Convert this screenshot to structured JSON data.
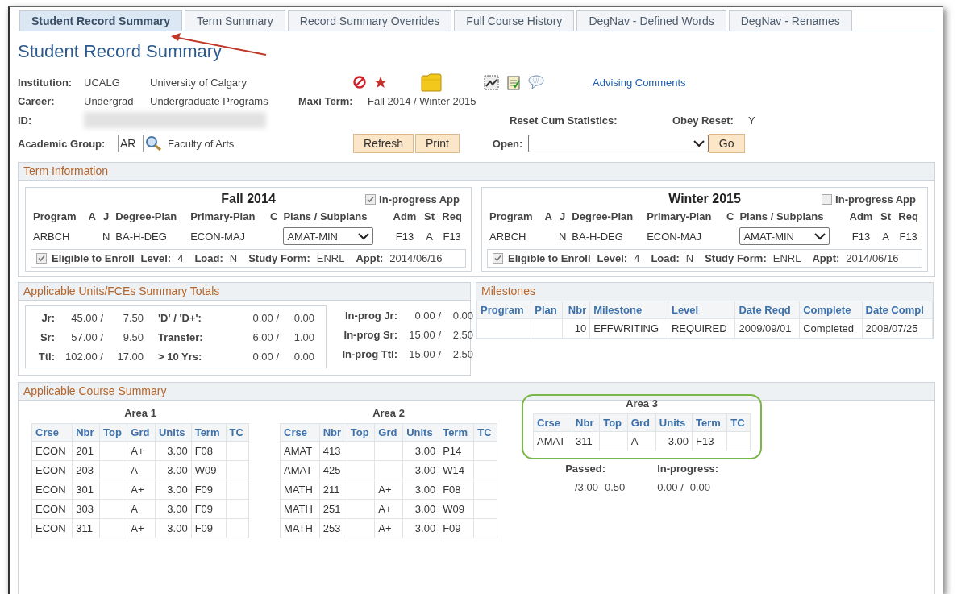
{
  "tabs": [
    {
      "label": "Student Record Summary",
      "selected": true
    },
    {
      "label": "Term Summary",
      "selected": false
    },
    {
      "label": "Record Summary Overrides",
      "selected": false
    },
    {
      "label": "Full Course History",
      "selected": false
    },
    {
      "label": "DegNav - Defined Words",
      "selected": false
    },
    {
      "label": "DegNav - Renames",
      "selected": false
    }
  ],
  "title": "Student Record Summary",
  "header": {
    "institution": {
      "label": "Institution:",
      "code": "UCALG",
      "name": "University of Calgary"
    },
    "career": {
      "label": "Career:",
      "code": "Undergrad",
      "name": "Undergraduate Programs"
    },
    "maxi_term": {
      "label": "Maxi Term:",
      "value": "Fall 2014 / Winter 2015"
    },
    "id": {
      "label": "ID:"
    },
    "reset_cum": {
      "label": "Reset Cum Statistics:"
    },
    "obey_reset": {
      "label": "Obey Reset:",
      "value": "Y"
    },
    "academic_group": {
      "label": "Academic Group:",
      "value": "AR",
      "name": "Faculty of Arts"
    },
    "buttons": [
      "Refresh",
      "Print"
    ],
    "open": {
      "label": "Open:"
    },
    "go": "Go",
    "link": "Advising Comments"
  },
  "term_information": {
    "title": "Term Information",
    "terms": [
      {
        "title": "Fall 2014",
        "in_progress": {
          "label": "In-progress App",
          "checked": true
        },
        "columns": [
          "Program",
          "A",
          "J",
          "Degree-Plan",
          "Primary-Plan",
          "C",
          "Plans / Subplans",
          "Adm",
          "St",
          "Req"
        ],
        "row": [
          {
            "kind": "text",
            "value": "ARBCH"
          },
          {
            "kind": "blank"
          },
          {
            "kind": "text",
            "value": "N"
          },
          {
            "kind": "text",
            "value": "BA-H-DEG"
          },
          {
            "kind": "text",
            "value": "ECON-MAJ"
          },
          {
            "kind": "blank"
          },
          {
            "kind": "select",
            "value": "AMAT-MIN"
          },
          {
            "kind": "text",
            "value": "F13"
          },
          {
            "kind": "text",
            "value": "A"
          },
          {
            "kind": "text",
            "value": "F13"
          }
        ],
        "eligible": {
          "label": "Eligible to Enroll",
          "checked": true
        },
        "fields": [
          {
            "label": "Level:",
            "value": "4"
          },
          {
            "label": "Load:",
            "value": "N"
          },
          {
            "label": "Study Form:",
            "value": "ENRL"
          },
          {
            "label": "Appt:",
            "value": "2014/06/16"
          }
        ]
      },
      {
        "title": "Winter 2015",
        "in_progress": {
          "label": "In-progress App",
          "checked": false
        },
        "columns": [
          "Program",
          "A",
          "J",
          "Degree-Plan",
          "Primary-Plan",
          "C",
          "Plans / Subplans",
          "Adm",
          "St",
          "Req"
        ],
        "row": [
          {
            "kind": "text",
            "value": "ARBCH"
          },
          {
            "kind": "blank"
          },
          {
            "kind": "text",
            "value": "N"
          },
          {
            "kind": "text",
            "value": "BA-H-DEG"
          },
          {
            "kind": "text",
            "value": "ECON-MAJ"
          },
          {
            "kind": "blank"
          },
          {
            "kind": "select",
            "value": "AMAT-MIN"
          },
          {
            "kind": "text",
            "value": "F13"
          },
          {
            "kind": "text",
            "value": "A"
          },
          {
            "kind": "text",
            "value": "F13"
          }
        ],
        "eligible": {
          "label": "Eligible to Enroll",
          "checked": true
        },
        "fields": [
          {
            "label": "Level:",
            "value": "4"
          },
          {
            "label": "Load:",
            "value": "N"
          },
          {
            "label": "Study Form:",
            "value": "ENRL"
          },
          {
            "label": "Appt:",
            "value": "2014/06/16"
          }
        ]
      }
    ]
  },
  "units": {
    "title": "Applicable Units/FCEs Summary Totals",
    "left_rows": [
      [
        "Jr:",
        "45.00 /",
        "7.50",
        "'D' / 'D+':",
        "0.00 /",
        "0.00"
      ],
      [
        "Sr:",
        "57.00 /",
        "9.50",
        "Transfer:",
        "6.00 /",
        "1.00"
      ],
      [
        "Ttl:",
        "102.00 /",
        "17.00",
        "> 10 Yrs:",
        "0.00 /",
        "0.00"
      ]
    ],
    "right_rows": [
      [
        "In-prog Jr:",
        "0.00 /",
        "0.00"
      ],
      [
        "In-prog Sr:",
        "15.00 /",
        "2.50"
      ],
      [
        "In-prog Ttl:",
        "15.00 /",
        "2.50"
      ]
    ]
  },
  "milestones": {
    "title": "Milestones",
    "columns": [
      "Program",
      "Plan",
      "Nbr",
      "Milestone",
      "Level",
      "Date Reqd",
      "Complete",
      "Date Compl"
    ],
    "rows": [
      [
        null,
        null,
        "10",
        "EFFWRITING",
        "REQUIRED",
        "2009/09/01",
        "Completed",
        "2008/07/25"
      ]
    ]
  },
  "course_summary": {
    "title": "Applicable Course Summary",
    "areas": [
      {
        "title": "Area 1",
        "highlighted": false,
        "columns": [
          "Crse",
          "Nbr",
          "Top",
          "Grd",
          "Units",
          "Term",
          "TC"
        ],
        "rows": [
          [
            "ECON",
            "201",
            null,
            "A+",
            "3.00",
            "F08",
            null
          ],
          [
            "ECON",
            "203",
            null,
            "A",
            "3.00",
            "W09",
            null
          ],
          [
            "ECON",
            "301",
            null,
            "A+",
            "3.00",
            "F09",
            null
          ],
          [
            "ECON",
            "303",
            null,
            "A",
            "3.00",
            "F09",
            null
          ],
          [
            "ECON",
            "311",
            null,
            "A+",
            "3.00",
            "F09",
            null
          ]
        ]
      },
      {
        "title": "Area 2",
        "highlighted": false,
        "columns": [
          "Crse",
          "Nbr",
          "Top",
          "Grd",
          "Units",
          "Term",
          "TC"
        ],
        "rows": [
          [
            "AMAT",
            "413",
            null,
            null,
            "3.00",
            "P14",
            null
          ],
          [
            "AMAT",
            "425",
            null,
            null,
            "3.00",
            "W14",
            null
          ],
          [
            "MATH",
            "211",
            null,
            "A+",
            "3.00",
            "F08",
            null
          ],
          [
            "MATH",
            "251",
            null,
            "A+",
            "3.00",
            "W09",
            null
          ],
          [
            "MATH",
            "253",
            null,
            "A+",
            "3.00",
            "F09",
            null
          ]
        ]
      },
      {
        "title": "Area 3",
        "highlighted": true,
        "columns": [
          "Crse",
          "Nbr",
          "Top",
          "Grd",
          "Units",
          "Term",
          "TC"
        ],
        "rows": [
          [
            "AMAT",
            "311",
            null,
            "A",
            "3.00",
            "F13",
            null
          ]
        ],
        "totals": {
          "passed_label": "Passed:",
          "passed_values": [
            "/3.00",
            "0.50"
          ],
          "in_progress_label": "In-progress:",
          "in_progress_values": [
            "0.00 /",
            "0.00"
          ]
        }
      }
    ]
  }
}
